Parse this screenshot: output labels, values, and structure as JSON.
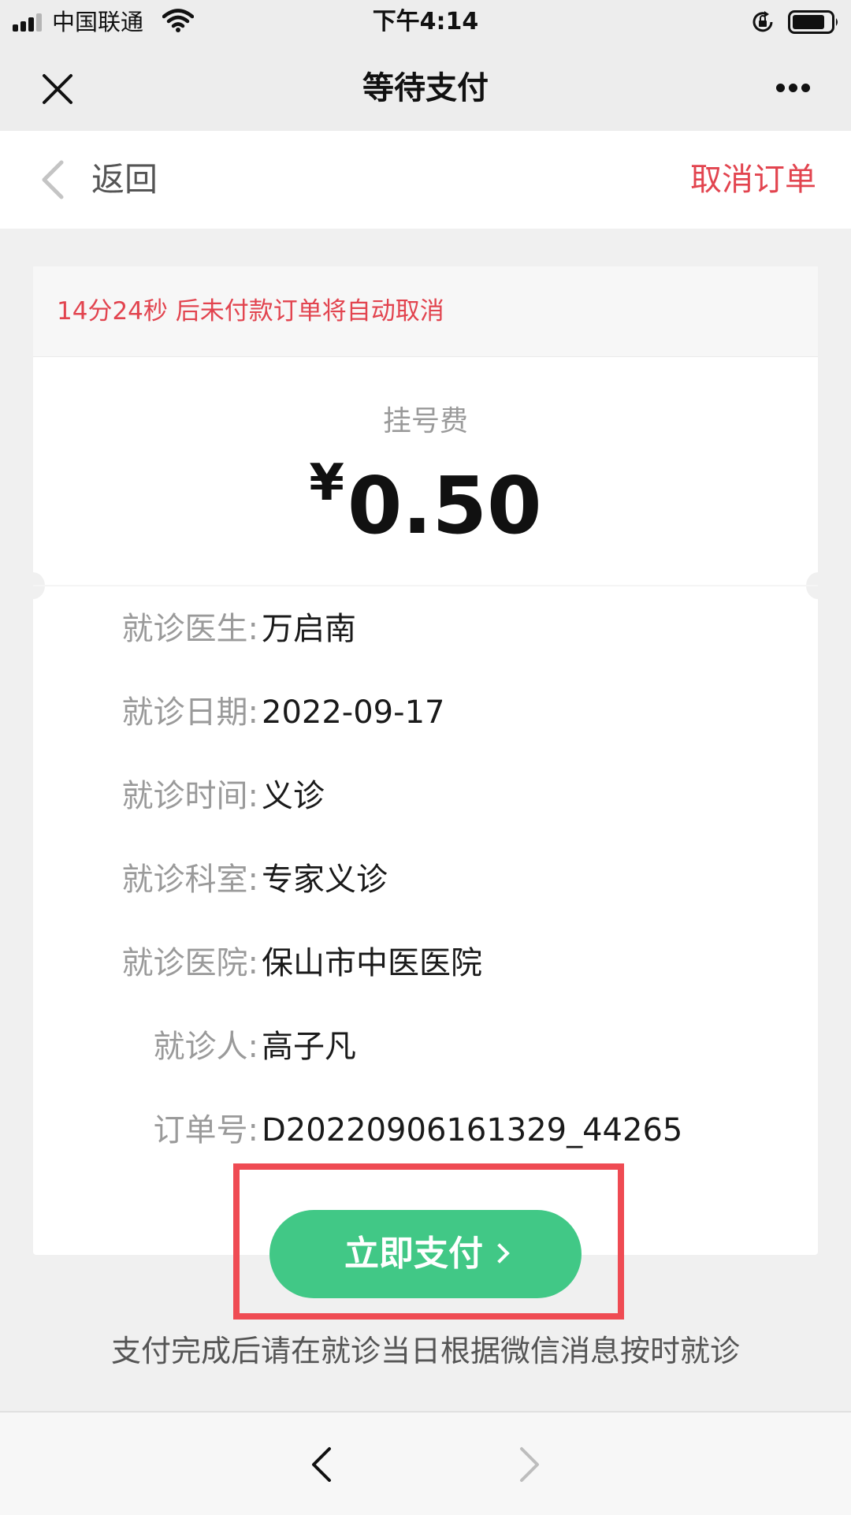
{
  "status_bar": {
    "carrier": "中国联通",
    "time": "下午4:14",
    "icons": [
      "signal-icon",
      "wifi-icon",
      "rotation-lock-icon",
      "battery-icon"
    ]
  },
  "title_bar": {
    "title": "等待支付",
    "icons": [
      "close-icon",
      "more-icon"
    ]
  },
  "nav": {
    "back_label": "返回",
    "cancel_label": "取消订单"
  },
  "order": {
    "countdown": "14分24秒 后未付款订单将自动取消",
    "fee_label": "挂号费",
    "currency_symbol": "¥",
    "amount": "0.50",
    "details": [
      {
        "label": "就诊医生:",
        "value": "万启南"
      },
      {
        "label": "就诊日期:",
        "value": "2022-09-17"
      },
      {
        "label": "就诊时间:",
        "value": "义诊"
      },
      {
        "label": "就诊科室:",
        "value": "专家义诊"
      },
      {
        "label": "就诊医院:",
        "value": "保山市中医医院"
      },
      {
        "label": "就诊人:",
        "value": "高子凡"
      },
      {
        "label": "订单号:",
        "value": "D20220906161329_44265"
      }
    ]
  },
  "pay_button_label": "立即支付",
  "notice": "支付完成后请在就诊当日根据微信消息按时就诊",
  "colors": {
    "accent_red": "#e2444f",
    "pay_green": "#41c886",
    "highlight_red": "#ef4b53"
  },
  "toolbar": {
    "icons": [
      "back-arrow-icon",
      "forward-arrow-icon"
    ]
  }
}
